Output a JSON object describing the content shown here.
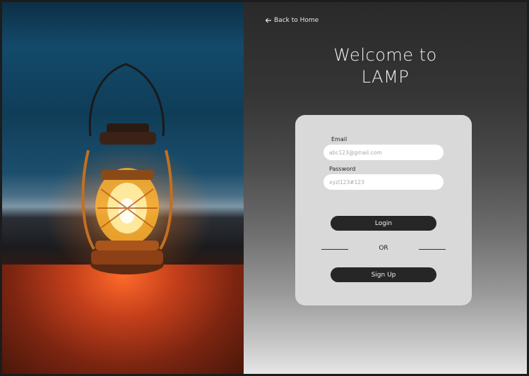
{
  "nav": {
    "back_label": "Back to Home"
  },
  "header": {
    "title_line1": "Welcome to",
    "title_line2": "LAMP"
  },
  "form": {
    "email_label": "Email",
    "email_placeholder": "abc123@gmail.com",
    "password_label": "Password",
    "password_placeholder": "xyzl123#123",
    "login_label": "Login",
    "divider_label": "OR",
    "signup_label": "Sign Up"
  },
  "colors": {
    "button_bg": "#262626",
    "card_bg": "#d9d9d9",
    "text_light": "#f2f2f2"
  },
  "hero_image": {
    "subject": "lantern-photo"
  }
}
